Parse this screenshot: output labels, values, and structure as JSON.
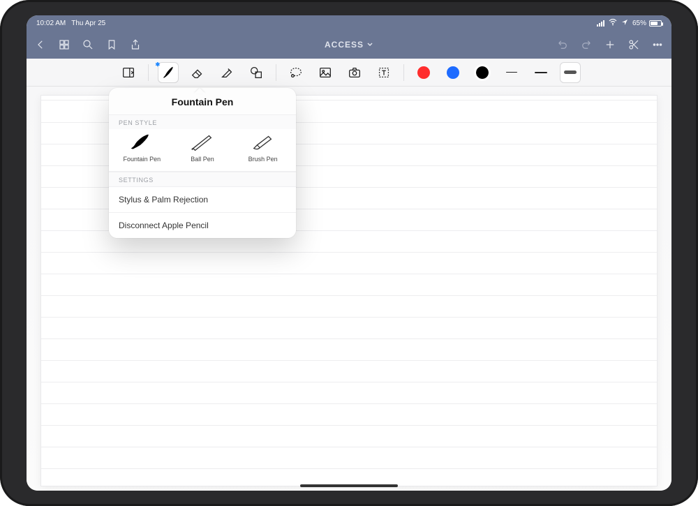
{
  "status": {
    "time": "10:02 AM",
    "date": "Thu Apr 25",
    "battery_pct": "65%"
  },
  "nav": {
    "title": "ACCESS"
  },
  "popover": {
    "title": "Fountain Pen",
    "section_pen": "PEN STYLE",
    "section_settings": "SETTINGS",
    "pens": {
      "fountain": "Fountain Pen",
      "ball": "Ball Pen",
      "brush": "Brush Pen"
    },
    "item_stylus": "Stylus & Palm Rejection",
    "item_disconnect": "Disconnect Apple Pencil"
  }
}
